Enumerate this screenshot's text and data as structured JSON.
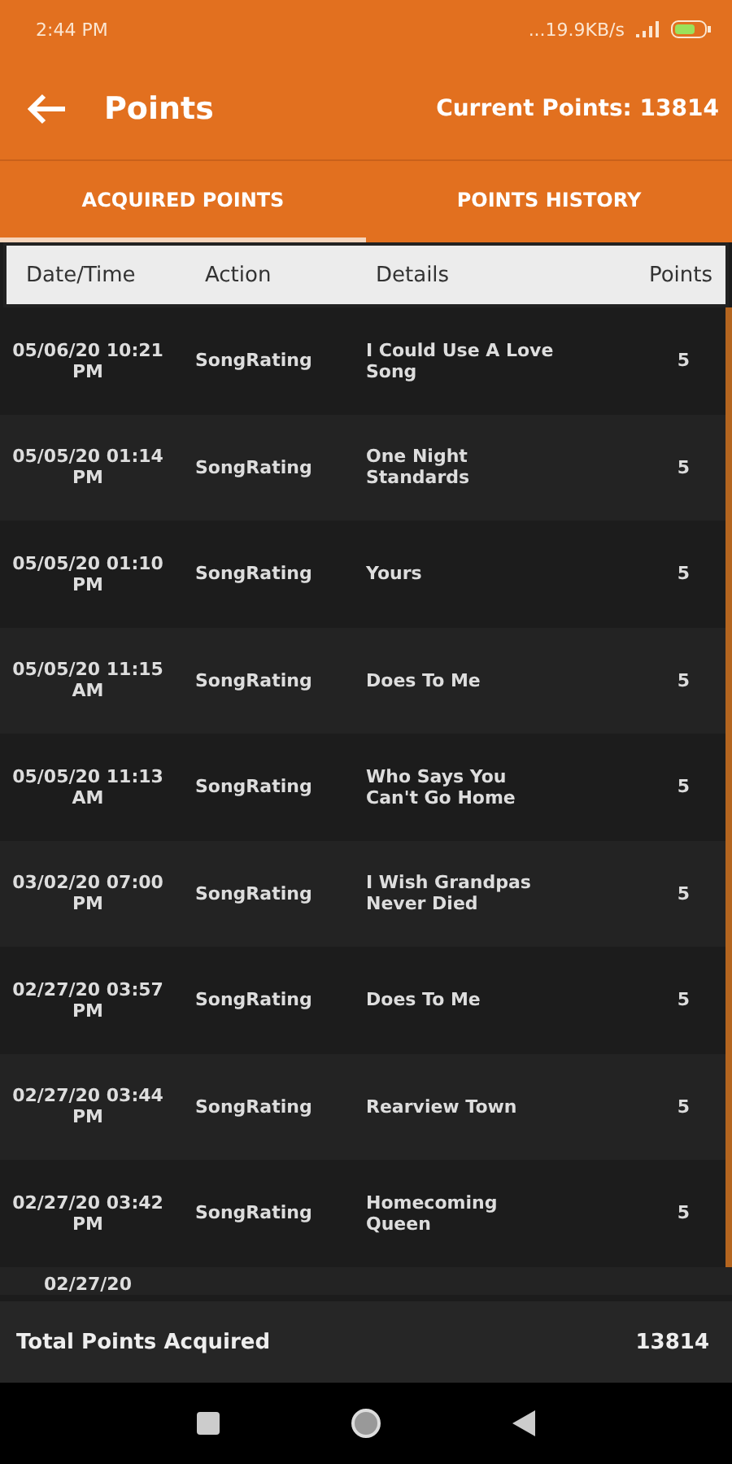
{
  "status_bar": {
    "time": "2:44 PM",
    "network_speed": "...19.9KB/s"
  },
  "app_bar": {
    "title": "Points",
    "current_points": "Current Points: 13814"
  },
  "tabs": [
    {
      "label": "ACQUIRED POINTS",
      "selected": true
    },
    {
      "label": "POINTS HISTORY",
      "selected": false
    }
  ],
  "table": {
    "columns": [
      "Date/Time",
      "Action",
      "Details",
      "Points"
    ],
    "rows": [
      {
        "date": "05/06/20 10:21 PM",
        "action": "SongRating",
        "details": "I Could Use A Love Song",
        "points": "5"
      },
      {
        "date": "05/05/20 01:14 PM",
        "action": "SongRating",
        "details": "One Night Standards",
        "points": "5"
      },
      {
        "date": "05/05/20 01:10 PM",
        "action": "SongRating",
        "details": "Yours",
        "points": "5"
      },
      {
        "date": "05/05/20 11:15 AM",
        "action": "SongRating",
        "details": "Does To Me",
        "points": "5"
      },
      {
        "date": "05/05/20 11:13 AM",
        "action": "SongRating",
        "details": "Who Says You Can't Go Home",
        "points": "5"
      },
      {
        "date": "03/02/20 07:00 PM",
        "action": "SongRating",
        "details": "I Wish Grandpas Never Died",
        "points": "5"
      },
      {
        "date": "02/27/20 03:57 PM",
        "action": "SongRating",
        "details": "Does To Me",
        "points": "5"
      },
      {
        "date": "02/27/20 03:44 PM",
        "action": "SongRating",
        "details": "Rearview Town",
        "points": "5"
      },
      {
        "date": "02/27/20 03:42 PM",
        "action": "SongRating",
        "details": "Homecoming Queen",
        "points": "5"
      },
      {
        "date": "02/27/20"
      }
    ]
  },
  "footer": {
    "label": "Total Points Acquired",
    "total": "13814"
  }
}
